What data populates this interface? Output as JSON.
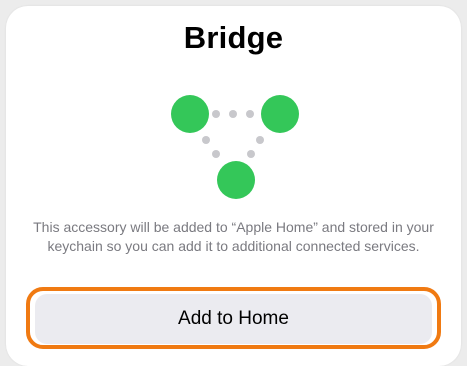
{
  "dialog": {
    "title": "Bridge",
    "description": "This accessory will be added to “Apple Home” and stored in your keychain so you can add it to additional connected services.",
    "primary_button_label": "Add to Home"
  },
  "diagram": {
    "icon": "bridge-network-icon",
    "node_color": "#34c759",
    "dot_color": "#c8c8cc"
  },
  "colors": {
    "highlight": "#f07a12",
    "button_bg": "#ebebf0",
    "text_secondary": "#7a7a80"
  }
}
